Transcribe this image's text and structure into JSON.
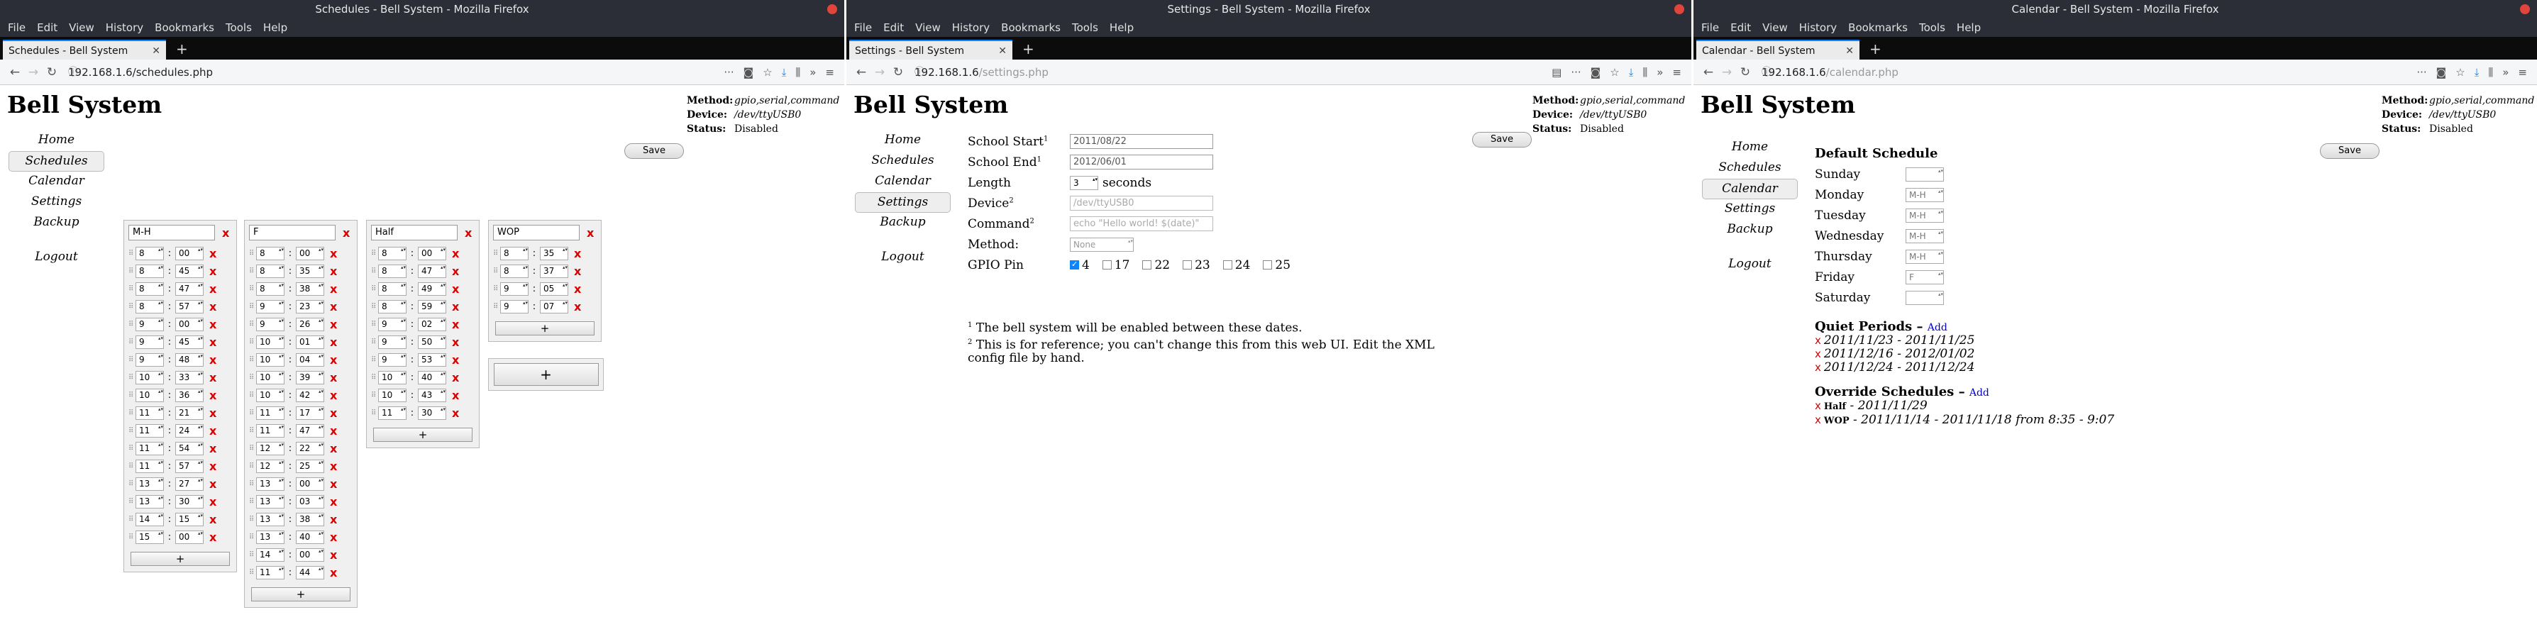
{
  "win1": {
    "title": "Schedules - Bell System - Mozilla Firefox",
    "tab": "Schedules - Bell System",
    "url_host": "192.168.1.6",
    "url_path": "/schedules.php"
  },
  "win2": {
    "title": "Settings - Bell System - Mozilla Firefox",
    "tab": "Settings - Bell System",
    "url_host": "192.168.1.6",
    "url_path": "/settings.php"
  },
  "win3": {
    "title": "Calendar - Bell System - Mozilla Firefox",
    "tab": "Calendar - Bell System",
    "url_host": "192.168.1.6",
    "url_path": "/calendar.php"
  },
  "menu": [
    "File",
    "Edit",
    "View",
    "History",
    "Bookmarks",
    "Tools",
    "Help"
  ],
  "heading": "Bell System",
  "nav": [
    "Home",
    "Schedules",
    "Calendar",
    "Settings",
    "Backup",
    "Logout"
  ],
  "status": {
    "method_label": "Method:",
    "method": "gpio,serial,command",
    "device_label": "Device:",
    "device": "/dev/ttyUSB0",
    "status_label": "Status:",
    "status": "Disabled"
  },
  "save_label": "Save",
  "plus": "+",
  "x": "x",
  "colon": ":",
  "schedules": [
    {
      "name": "M-H",
      "times": [
        [
          "8",
          "00"
        ],
        [
          "8",
          "45"
        ],
        [
          "8",
          "47"
        ],
        [
          "8",
          "57"
        ],
        [
          "9",
          "00"
        ],
        [
          "9",
          "45"
        ],
        [
          "9",
          "48"
        ],
        [
          "10",
          "33"
        ],
        [
          "10",
          "36"
        ],
        [
          "11",
          "21"
        ],
        [
          "11",
          "24"
        ],
        [
          "11",
          "54"
        ],
        [
          "11",
          "57"
        ],
        [
          "13",
          "27"
        ],
        [
          "13",
          "30"
        ],
        [
          "14",
          "15"
        ],
        [
          "15",
          "00"
        ]
      ]
    },
    {
      "name": "F",
      "times": [
        [
          "8",
          "00"
        ],
        [
          "8",
          "35"
        ],
        [
          "8",
          "38"
        ],
        [
          "9",
          "23"
        ],
        [
          "9",
          "26"
        ],
        [
          "10",
          "01"
        ],
        [
          "10",
          "04"
        ],
        [
          "10",
          "39"
        ],
        [
          "10",
          "42"
        ],
        [
          "11",
          "17"
        ],
        [
          "11",
          "47"
        ],
        [
          "12",
          "22"
        ],
        [
          "12",
          "25"
        ],
        [
          "13",
          "00"
        ],
        [
          "13",
          "03"
        ],
        [
          "13",
          "38"
        ],
        [
          "13",
          "40"
        ],
        [
          "14",
          "00"
        ],
        [
          "11",
          "44"
        ]
      ]
    },
    {
      "name": "Half",
      "times": [
        [
          "8",
          "00"
        ],
        [
          "8",
          "47"
        ],
        [
          "8",
          "49"
        ],
        [
          "8",
          "59"
        ],
        [
          "9",
          "02"
        ],
        [
          "9",
          "50"
        ],
        [
          "9",
          "53"
        ],
        [
          "10",
          "40"
        ],
        [
          "10",
          "43"
        ],
        [
          "11",
          "30"
        ]
      ]
    },
    {
      "name": "WOP",
      "times": [
        [
          "8",
          "35"
        ],
        [
          "8",
          "37"
        ],
        [
          "9",
          "05"
        ],
        [
          "9",
          "07"
        ]
      ]
    }
  ],
  "settings": {
    "school_start_label": "School Start",
    "school_start": "2011/08/22",
    "school_end_label": "School End",
    "school_end": "2012/06/01",
    "length_label": "Length",
    "length": "3",
    "length_unit": "seconds",
    "device_label": "Device",
    "device_placeholder": "/dev/ttyUSB0",
    "command_label": "Command",
    "command_placeholder": "echo \"Hello world! $(date)\"",
    "method_label": "Method:",
    "method": "None",
    "gpio_label": "GPIO Pin",
    "gpio_pins": [
      {
        "n": "4",
        "checked": true
      },
      {
        "n": "17",
        "checked": false
      },
      {
        "n": "22",
        "checked": false
      },
      {
        "n": "23",
        "checked": false
      },
      {
        "n": "24",
        "checked": false
      },
      {
        "n": "25",
        "checked": false
      }
    ],
    "note1": "The bell system will be enabled between these dates.",
    "note2": "This is for reference; you can't change this from this web UI. Edit the XML config file by hand.",
    "sup1": "1",
    "sup2": "2"
  },
  "calendar": {
    "default_heading": "Default Schedule",
    "days": [
      {
        "d": "Sunday",
        "v": ""
      },
      {
        "d": "Monday",
        "v": "M-H"
      },
      {
        "d": "Tuesday",
        "v": "M-H"
      },
      {
        "d": "Wednesday",
        "v": "M-H"
      },
      {
        "d": "Thursday",
        "v": "M-H"
      },
      {
        "d": "Friday",
        "v": "F"
      },
      {
        "d": "Saturday",
        "v": ""
      }
    ],
    "quiet_heading": "Quiet Periods",
    "override_heading": "Override Schedules",
    "add": "Add",
    "dash": " – ",
    "quiet": [
      "2011/11/23 - 2011/11/25",
      "2011/12/16 - 2012/01/02",
      "2011/12/24 - 2011/12/24"
    ],
    "overrides": [
      {
        "name": "Half",
        "text": " - 2011/11/29"
      },
      {
        "name": "WOP",
        "text": " - 2011/11/14 - 2011/11/18 from 8:35 - 9:07"
      }
    ]
  }
}
